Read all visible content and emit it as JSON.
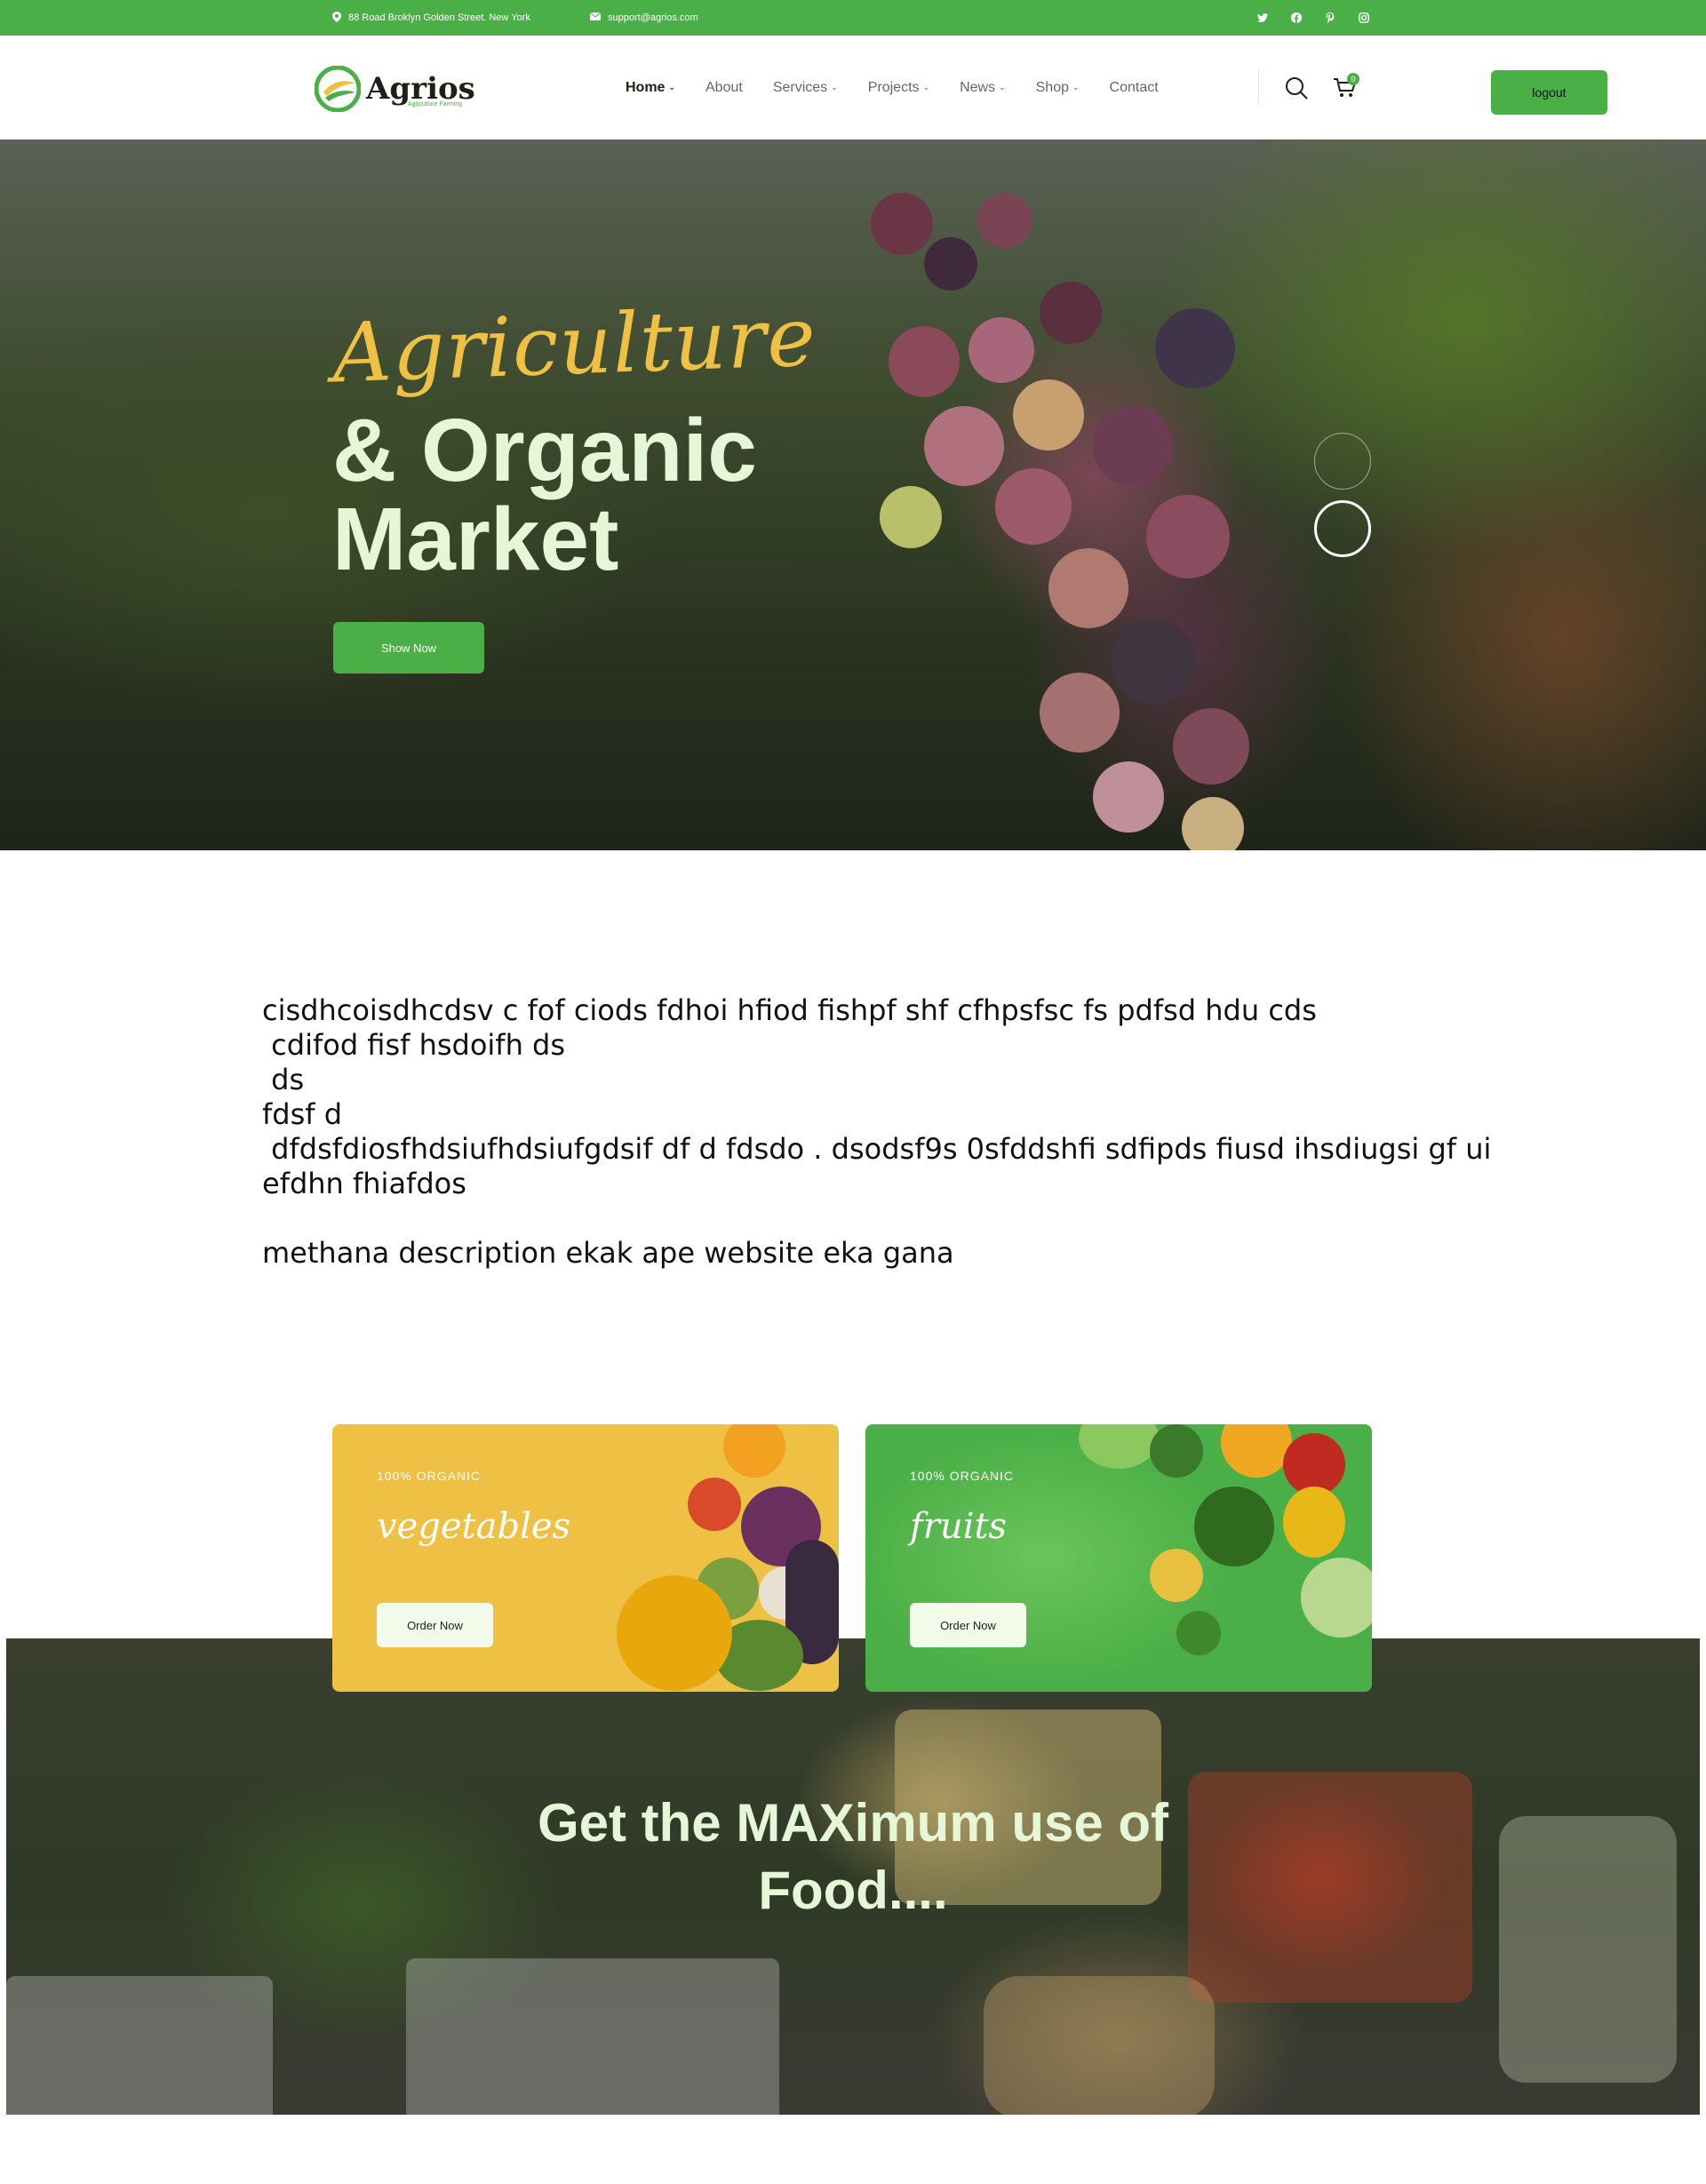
{
  "topbar": {
    "address": "88 Road Broklyn Golden Street. New York",
    "email": "support@agrios.com",
    "social": [
      "twitter-icon",
      "facebook-icon",
      "pinterest-icon",
      "instagram-icon"
    ]
  },
  "header": {
    "logo_name": "Agrios",
    "logo_tagline": "Agriculture Farming",
    "nav": [
      {
        "label": "Home",
        "dropdown": true,
        "active": true
      },
      {
        "label": "About",
        "dropdown": false
      },
      {
        "label": "Services",
        "dropdown": true
      },
      {
        "label": "Projects",
        "dropdown": true
      },
      {
        "label": "News",
        "dropdown": true
      },
      {
        "label": "Shop",
        "dropdown": true
      },
      {
        "label": "Contact",
        "dropdown": false
      }
    ],
    "cart_count": "0",
    "logout_label": "logout"
  },
  "hero": {
    "script_title": "Agriculture",
    "title_line1": "& Organic",
    "title_line2": "Market",
    "button_label": "Show Now"
  },
  "description": "cisdhcoisdhcdsv c fof ciods fdhoi hfiod fishpf shf cfhpsfsc fs pdfsd hdu cds\n cdifod fisf hsdoifh ds\n ds\nfdsf d\n dfdsfdiosfhdsiufhdsiufgdsif df d fdsdo . dsodsf9s 0sfddshfi sdfipds fiusd ihsdiugsi gf ui\nefdhn fhiafdos\n\nmethana description ekak ape website eka gana",
  "cards": [
    {
      "eyebrow": "100% ORGANIC",
      "title": "vegetables",
      "button": "Order Now"
    },
    {
      "eyebrow": "100% ORGANIC",
      "title": "fruits",
      "button": "Order Now"
    }
  ],
  "banner": {
    "title_line1": "Get the MAXimum use of",
    "title_line2": "Food...."
  },
  "colors": {
    "brand_green": "#4baf47",
    "accent_yellow": "#eec044",
    "hero_text": "#e6f7d8"
  }
}
